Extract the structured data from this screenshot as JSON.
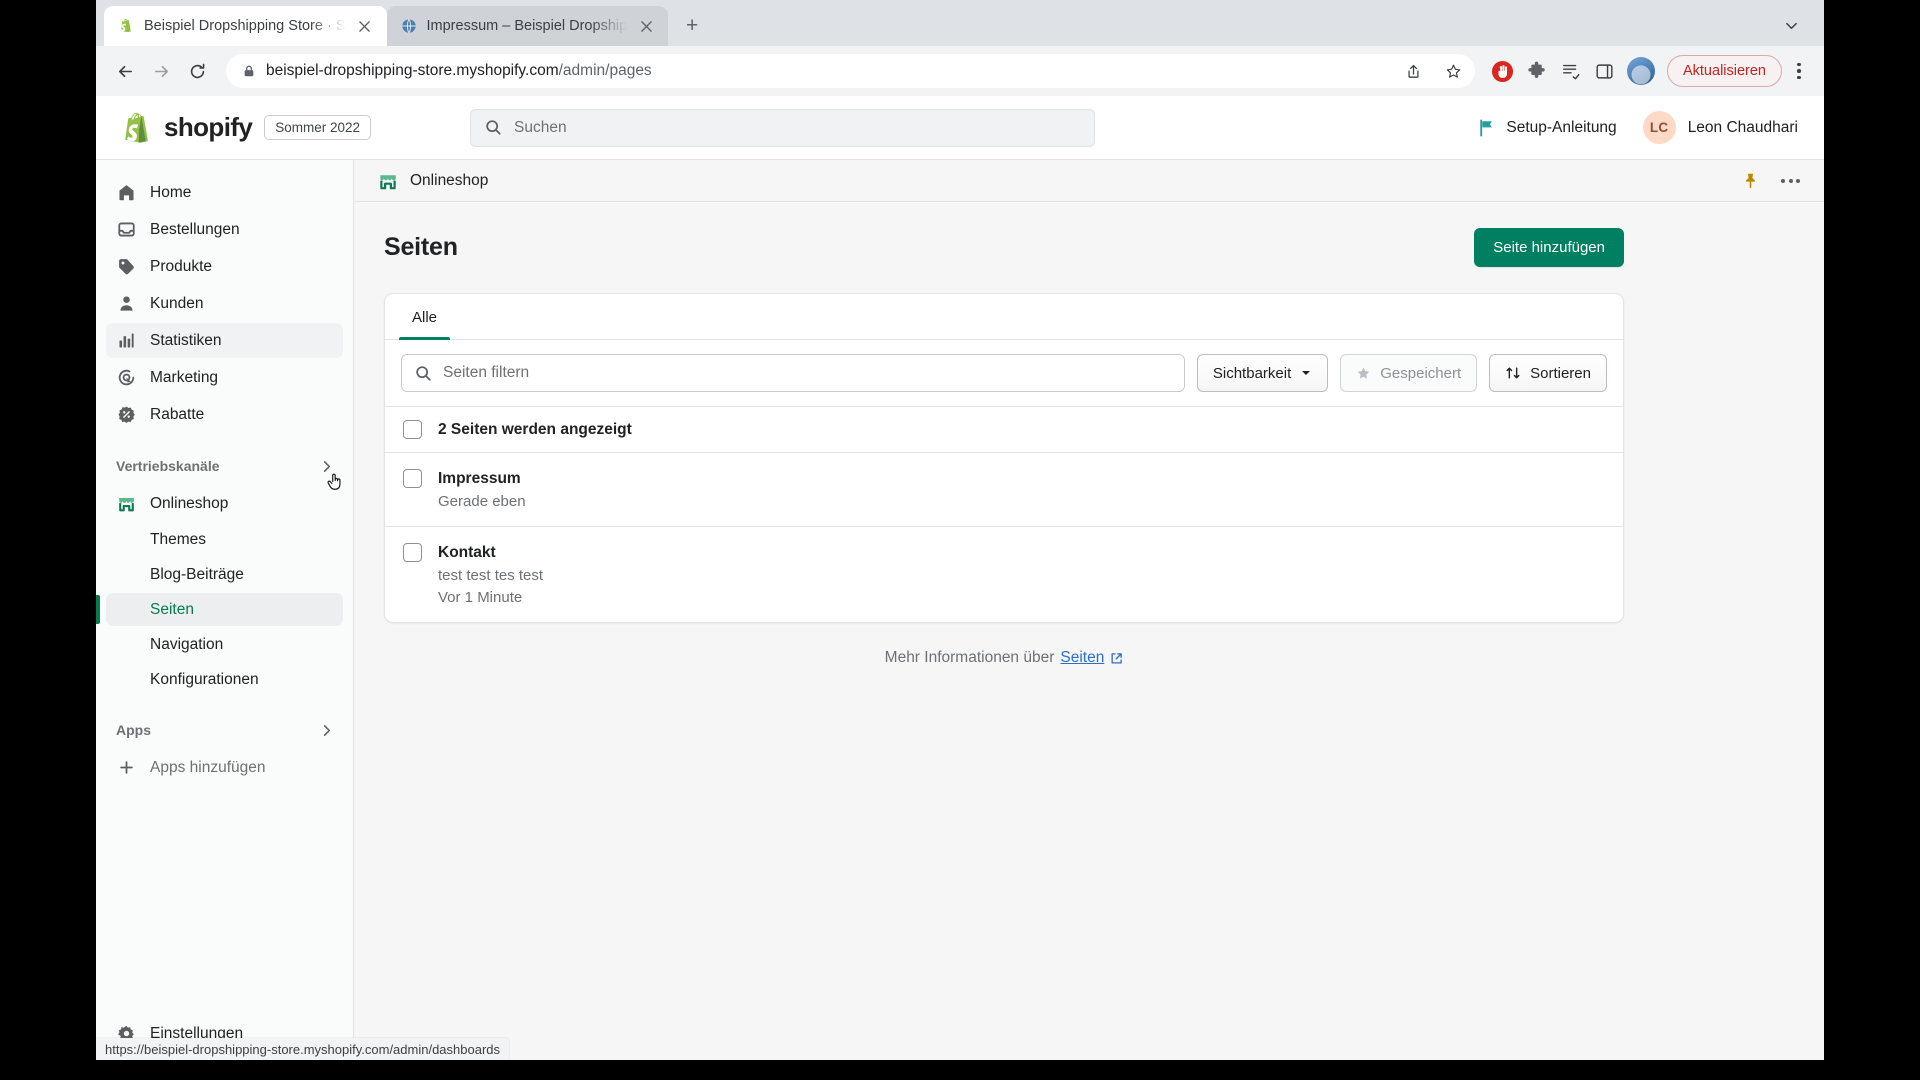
{
  "browser": {
    "tabs": [
      {
        "title": "Beispiel Dropshipping Store · S",
        "favicon": "shopify-icon",
        "active": true
      },
      {
        "title": "Impressum – Beispiel Dropship",
        "favicon": "globe-icon",
        "active": false
      }
    ],
    "newtab_label": "+",
    "toolbar": {
      "back": "back-icon",
      "forward": "forward-icon",
      "reload": "reload-icon",
      "url_bold": "beispiel-dropshipping-store.myshopify.com",
      "url_dim": "/admin/pages",
      "update_label": "Aktualisieren"
    },
    "statusbar_url": "https://beispiel-dropshipping-store.myshopify.com/admin/dashboards"
  },
  "topbar": {
    "logo_word": "shopify",
    "season_badge": "Sommer 2022",
    "search_placeholder": "Suchen",
    "setup_label": "Setup-Anleitung",
    "user_initials": "LC",
    "user_name": "Leon Chaudhari"
  },
  "sidebar": {
    "items": [
      {
        "label": "Home",
        "icon": "home-icon"
      },
      {
        "label": "Bestellungen",
        "icon": "orders-icon"
      },
      {
        "label": "Produkte",
        "icon": "tag-icon"
      },
      {
        "label": "Kunden",
        "icon": "person-icon"
      },
      {
        "label": "Statistiken",
        "icon": "bar-chart-icon",
        "hovered": true
      },
      {
        "label": "Marketing",
        "icon": "target-icon"
      },
      {
        "label": "Rabatte",
        "icon": "discount-icon"
      }
    ],
    "channels_group": "Vertriebskanäle",
    "channel": {
      "label": "Onlineshop",
      "icon": "storefront-icon"
    },
    "sub_items": [
      {
        "label": "Themes",
        "active": false
      },
      {
        "label": "Blog-Beiträge",
        "active": false
      },
      {
        "label": "Seiten",
        "active": true
      },
      {
        "label": "Navigation",
        "active": false
      },
      {
        "label": "Konfigurationen",
        "active": false
      }
    ],
    "apps_group": "Apps",
    "add_apps": "Apps hinzufügen",
    "settings": "Einstellungen"
  },
  "breadcrumb": {
    "label": "Onlineshop",
    "icon": "storefront-icon"
  },
  "page": {
    "title": "Seiten",
    "add_button": "Seite hinzufügen",
    "tabs": [
      {
        "label": "Alle",
        "active": true
      }
    ],
    "filter_placeholder": "Seiten filtern",
    "visibility_button": "Sichtbarkeit",
    "saved_button": "Gespeichert",
    "sort_button": "Sortieren",
    "list_count_label": "2 Seiten werden angezeigt",
    "rows": [
      {
        "title": "Impressum",
        "excerpt": "",
        "time": "Gerade eben"
      },
      {
        "title": "Kontakt",
        "excerpt": "test test tes test",
        "time": "Vor 1 Minute"
      }
    ],
    "footer_text": "Mehr Informationen über",
    "footer_link": "Seiten"
  },
  "colors": {
    "shopify_green": "#008060",
    "active_green": "#067a4b",
    "link_blue": "#2c6ecb",
    "update_red": "#c5221f",
    "teal_flag": "#2a9d9d"
  }
}
